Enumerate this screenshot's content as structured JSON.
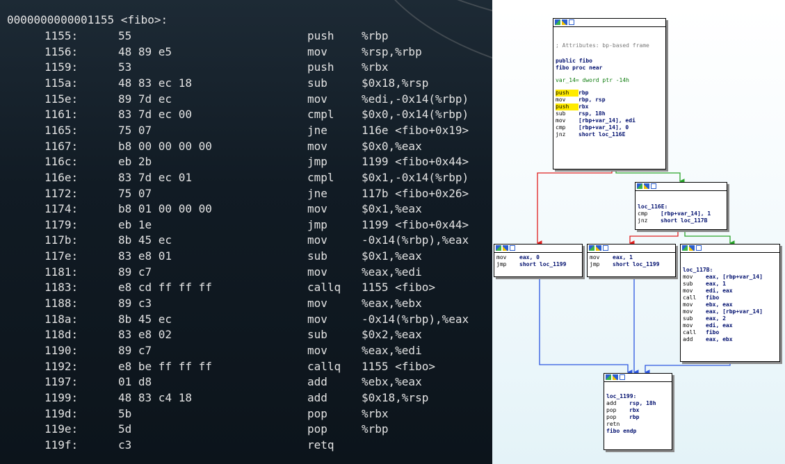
{
  "disasm": {
    "header": "0000000000001155 <fibo>:",
    "rows": [
      {
        "addr": "1155:",
        "bytes": "55",
        "mnemonic": "push",
        "operands": "%rbp"
      },
      {
        "addr": "1156:",
        "bytes": "48 89 e5",
        "mnemonic": "mov",
        "operands": "%rsp,%rbp"
      },
      {
        "addr": "1159:",
        "bytes": "53",
        "mnemonic": "push",
        "operands": "%rbx"
      },
      {
        "addr": "115a:",
        "bytes": "48 83 ec 18",
        "mnemonic": "sub",
        "operands": "$0x18,%rsp"
      },
      {
        "addr": "115e:",
        "bytes": "89 7d ec",
        "mnemonic": "mov",
        "operands": "%edi,-0x14(%rbp)"
      },
      {
        "addr": "1161:",
        "bytes": "83 7d ec 00",
        "mnemonic": "cmpl",
        "operands": "$0x0,-0x14(%rbp)"
      },
      {
        "addr": "1165:",
        "bytes": "75 07",
        "mnemonic": "jne",
        "operands": "116e <fibo+0x19>"
      },
      {
        "addr": "1167:",
        "bytes": "b8 00 00 00 00",
        "mnemonic": "mov",
        "operands": "$0x0,%eax"
      },
      {
        "addr": "116c:",
        "bytes": "eb 2b",
        "mnemonic": "jmp",
        "operands": "1199 <fibo+0x44>"
      },
      {
        "addr": "116e:",
        "bytes": "83 7d ec 01",
        "mnemonic": "cmpl",
        "operands": "$0x1,-0x14(%rbp)"
      },
      {
        "addr": "1172:",
        "bytes": "75 07",
        "mnemonic": "jne",
        "operands": "117b <fibo+0x26>"
      },
      {
        "addr": "1174:",
        "bytes": "b8 01 00 00 00",
        "mnemonic": "mov",
        "operands": "$0x1,%eax"
      },
      {
        "addr": "1179:",
        "bytes": "eb 1e",
        "mnemonic": "jmp",
        "operands": "1199 <fibo+0x44>"
      },
      {
        "addr": "117b:",
        "bytes": "8b 45 ec",
        "mnemonic": "mov",
        "operands": "-0x14(%rbp),%eax"
      },
      {
        "addr": "117e:",
        "bytes": "83 e8 01",
        "mnemonic": "sub",
        "operands": "$0x1,%eax"
      },
      {
        "addr": "1181:",
        "bytes": "89 c7",
        "mnemonic": "mov",
        "operands": "%eax,%edi"
      },
      {
        "addr": "1183:",
        "bytes": "e8 cd ff ff ff",
        "mnemonic": "callq",
        "operands": "1155 <fibo>"
      },
      {
        "addr": "1188:",
        "bytes": "89 c3",
        "mnemonic": "mov",
        "operands": "%eax,%ebx"
      },
      {
        "addr": "118a:",
        "bytes": "8b 45 ec",
        "mnemonic": "mov",
        "operands": "-0x14(%rbp),%eax"
      },
      {
        "addr": "118d:",
        "bytes": "83 e8 02",
        "mnemonic": "sub",
        "operands": "$0x2,%eax"
      },
      {
        "addr": "1190:",
        "bytes": "89 c7",
        "mnemonic": "mov",
        "operands": "%eax,%edi"
      },
      {
        "addr": "1192:",
        "bytes": "e8 be ff ff ff",
        "mnemonic": "callq",
        "operands": "1155 <fibo>"
      },
      {
        "addr": "1197:",
        "bytes": "01 d8",
        "mnemonic": "add",
        "operands": "%ebx,%eax"
      },
      {
        "addr": "1199:",
        "bytes": "48 83 c4 18",
        "mnemonic": "add",
        "operands": "$0x18,%rsp"
      },
      {
        "addr": "119d:",
        "bytes": "5b",
        "mnemonic": "pop",
        "operands": "%rbx"
      },
      {
        "addr": "119e:",
        "bytes": "5d",
        "mnemonic": "pop",
        "operands": "%rbp"
      },
      {
        "addr": "119f:",
        "bytes": "c3",
        "mnemonic": "retq",
        "operands": ""
      }
    ]
  },
  "graph": {
    "node_icons": [
      "graph-icon",
      "chart-icon",
      "text-view-icon"
    ],
    "edge_colors": {
      "taken": "#2aa52a",
      "not_taken": "#e02020",
      "unconditional": "#2a55e0"
    },
    "nodes": {
      "entry": {
        "comment": "; Attributes: bp-based frame",
        "public": "public fibo",
        "proc": "fibo proc near",
        "var": "var_14= dword ptr -14h",
        "insns": [
          {
            "mn": "push",
            "op": "rbp",
            "hl": true
          },
          {
            "mn": "mov",
            "op": "rbp, rsp",
            "hl": false
          },
          {
            "mn": "push",
            "op": "rbx",
            "hl": true
          },
          {
            "mn": "sub",
            "op": "rsp, 18h",
            "hl": false
          },
          {
            "mn": "mov",
            "op": "[rbp+var_14], edi",
            "hl": false
          },
          {
            "mn": "cmp",
            "op": "[rbp+var_14], 0",
            "hl": false
          },
          {
            "mn": "jnz",
            "op": "short loc_116E",
            "hl": false
          }
        ]
      },
      "loc_116e": {
        "label": "loc_116E:",
        "insns": [
          {
            "mn": "cmp",
            "op": "[rbp+var_14], 1"
          },
          {
            "mn": "jnz",
            "op": "short loc_117B"
          }
        ]
      },
      "ret0": {
        "insns": [
          {
            "mn": "mov",
            "op": "eax, 0"
          },
          {
            "mn": "jmp",
            "op": "short loc_1199"
          }
        ]
      },
      "ret1": {
        "insns": [
          {
            "mn": "mov",
            "op": "eax, 1"
          },
          {
            "mn": "jmp",
            "op": "short loc_1199"
          }
        ]
      },
      "loc_117b": {
        "label": "loc_117B:",
        "insns": [
          {
            "mn": "mov",
            "op": "eax, [rbp+var_14]"
          },
          {
            "mn": "sub",
            "op": "eax, 1"
          },
          {
            "mn": "mov",
            "op": "edi, eax"
          },
          {
            "mn": "call",
            "op": "fibo"
          },
          {
            "mn": "mov",
            "op": "ebx, eax"
          },
          {
            "mn": "mov",
            "op": "eax, [rbp+var_14]"
          },
          {
            "mn": "sub",
            "op": "eax, 2"
          },
          {
            "mn": "mov",
            "op": "edi, eax"
          },
          {
            "mn": "call",
            "op": "fibo"
          },
          {
            "mn": "add",
            "op": "eax, ebx"
          }
        ]
      },
      "loc_1199": {
        "label": "loc_1199:",
        "insns": [
          {
            "mn": "add",
            "op": "rsp, 18h"
          },
          {
            "mn": "pop",
            "op": "rbx"
          },
          {
            "mn": "pop",
            "op": "rbp"
          },
          {
            "mn": "retn",
            "op": ""
          }
        ],
        "end": "fibo endp"
      }
    }
  }
}
